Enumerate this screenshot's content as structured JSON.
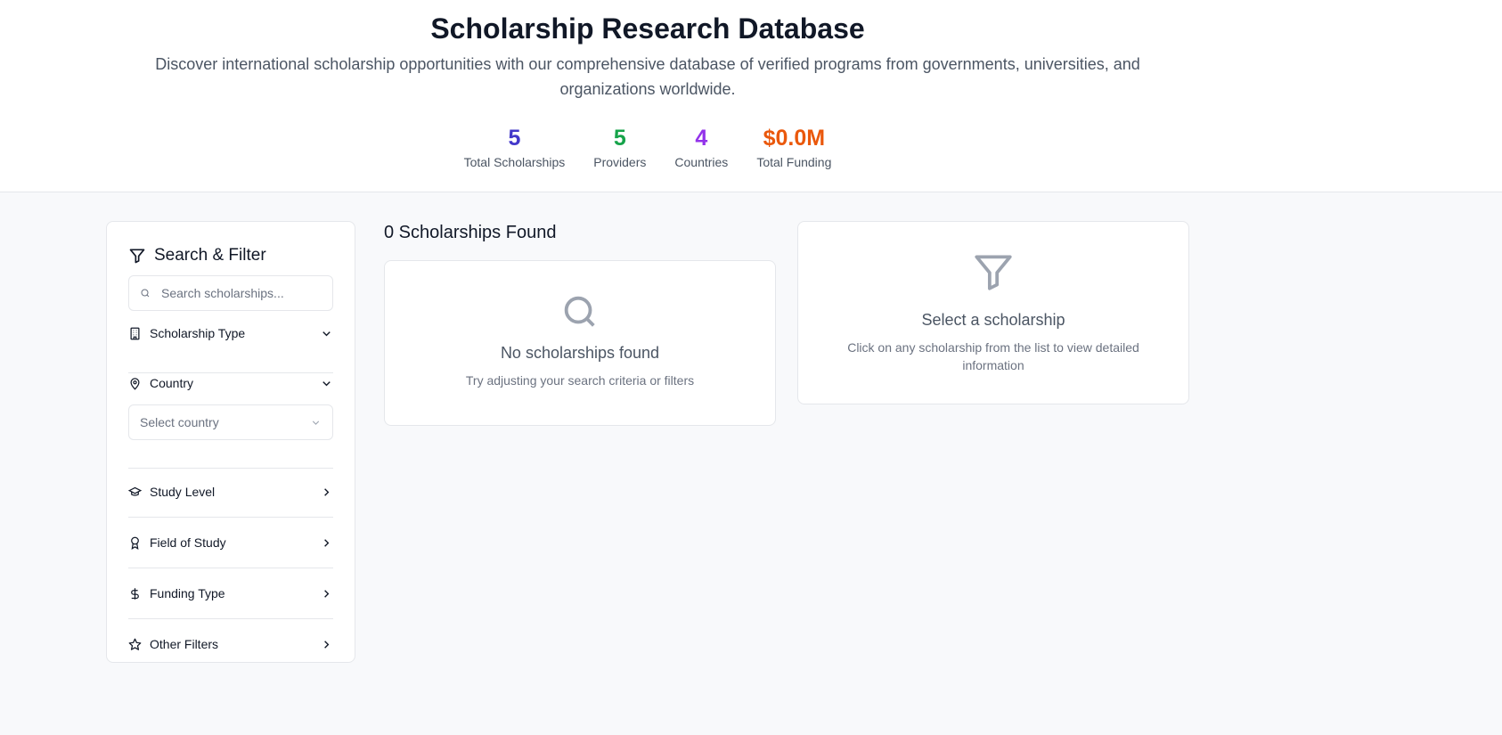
{
  "hero": {
    "title": "Scholarship Research Database",
    "subtitle": "Discover international scholarship opportunities with our comprehensive database of verified programs from governments, universities, and organizations worldwide."
  },
  "stats": [
    {
      "value": "5",
      "label": "Total Scholarships",
      "color": "#4338ca"
    },
    {
      "value": "5",
      "label": "Providers",
      "color": "#16a34a"
    },
    {
      "value": "4",
      "label": "Countries",
      "color": "#9333ea"
    },
    {
      "value": "$0.0M",
      "label": "Total Funding",
      "color": "#ea580c"
    }
  ],
  "sidebar": {
    "title": "Search & Filter",
    "search_placeholder": "Search scholarships...",
    "filters": {
      "scholarship_type": "Scholarship Type",
      "country": "Country",
      "country_select_placeholder": "Select country",
      "study_level": "Study Level",
      "field_of_study": "Field of Study",
      "funding_type": "Funding Type",
      "other_filters": "Other Filters"
    }
  },
  "results": {
    "title": "0 Scholarships Found",
    "empty_title": "No scholarships found",
    "empty_text": "Try adjusting your search criteria or filters"
  },
  "detail": {
    "title": "Select a scholarship",
    "text": "Click on any scholarship from the list to view detailed information"
  }
}
